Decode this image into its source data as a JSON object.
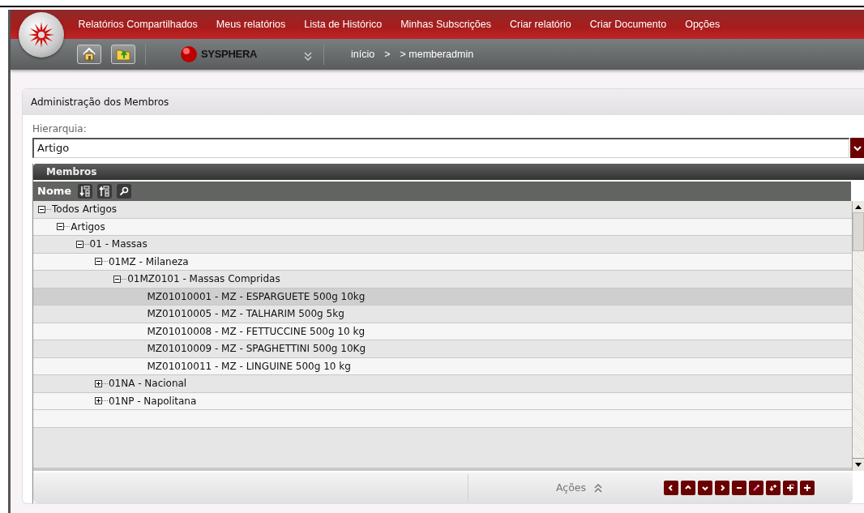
{
  "menu": [
    "Relatórios Compartilhados",
    "Meus relatórios",
    "Lista de Histórico",
    "Minhas Subscrições",
    "Criar relatório",
    "Criar Documento",
    "Opções"
  ],
  "brand": "SYSPHERA",
  "breadcrumb": [
    "início",
    ">",
    "> memberadmin"
  ],
  "panel": {
    "title": "Administração dos Membros",
    "hierarchy": {
      "label": "Hierarquia:",
      "value": "Artigo"
    },
    "members": {
      "title": "Membros",
      "column": "Nome",
      "tree": [
        {
          "label": "Todos Artigos",
          "expanded": true,
          "selected": false,
          "children": [
            {
              "label": "Artigos",
              "expanded": true,
              "selected": false,
              "children": [
                {
                  "label": "01 - Massas",
                  "expanded": true,
                  "selected": false,
                  "children": [
                    {
                      "label": "01MZ - Milaneza",
                      "expanded": true,
                      "selected": false,
                      "children": [
                        {
                          "label": "01MZ0101 - Massas Compridas",
                          "expanded": true,
                          "selected": false,
                          "children": [
                            {
                              "label": "MZ01010001 - MZ - ESPARGUETE 500g 10kg",
                              "selected": true
                            },
                            {
                              "label": "MZ01010005 - MZ - TALHARIM 500g 5kg",
                              "selected": false
                            },
                            {
                              "label": "MZ01010008 - MZ - FETTUCCINE 500g 10 kg",
                              "selected": false
                            },
                            {
                              "label": "MZ01010009 - MZ - SPAGHETTINI 500g 10Kg",
                              "selected": false
                            },
                            {
                              "label": "MZ01010011 - MZ - LINGUINE 500g 10 kg",
                              "selected": false
                            }
                          ]
                        }
                      ]
                    },
                    {
                      "label": "01NA - Nacional",
                      "expanded": false,
                      "selected": false
                    },
                    {
                      "label": "01NP - Napolitana",
                      "expanded": false,
                      "selected": false
                    }
                  ]
                }
              ]
            }
          ]
        }
      ]
    },
    "footer": {
      "actions_label": "Ações"
    }
  }
}
